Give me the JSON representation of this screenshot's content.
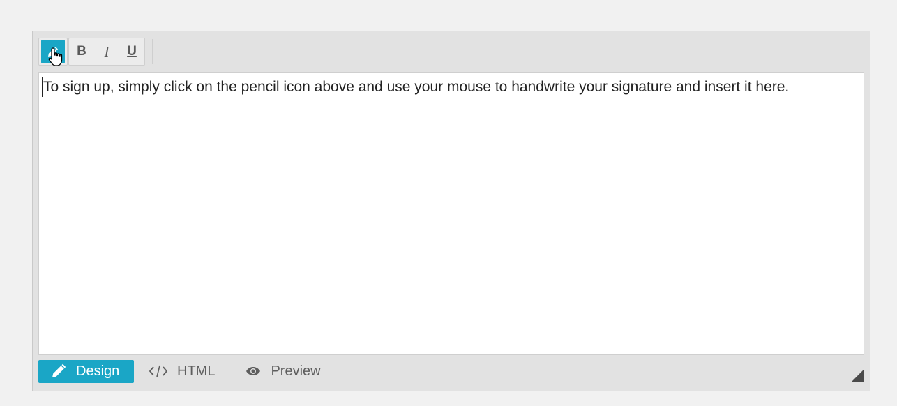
{
  "toolbar": {
    "pencil_icon": "pencil-icon",
    "bold_label": "B",
    "italic_label": "I",
    "underline_label": "U"
  },
  "content": {
    "text": "To sign up, simply click on the pencil icon above and use your mouse to handwrite your signature and insert it here."
  },
  "modes": {
    "design": "Design",
    "html": "HTML",
    "preview": "Preview"
  },
  "colors": {
    "accent": "#1aa6c6",
    "toolbar_bg": "#e2e2e2",
    "page_bg": "#f1f1f1"
  }
}
